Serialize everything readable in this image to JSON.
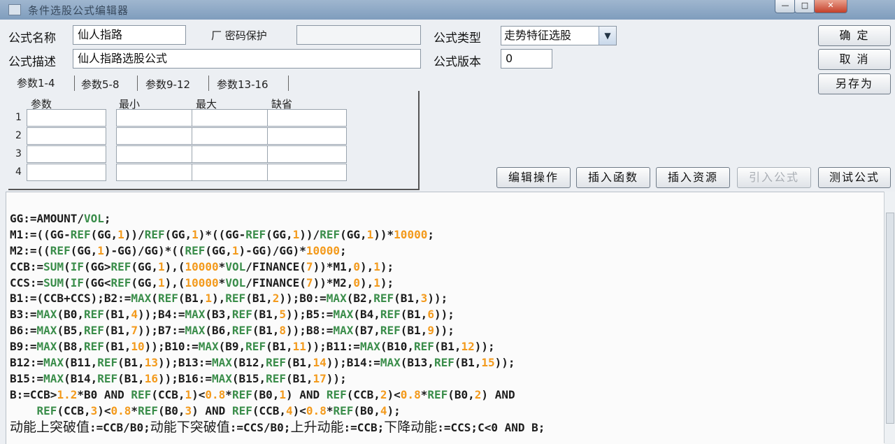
{
  "window": {
    "title": "条件选股公式编辑器",
    "minimize": "—",
    "maximize": "□",
    "close": "✕"
  },
  "form": {
    "name_label": "公式名称",
    "name_value": "仙人指路",
    "password_checkbox": "厂 密码保护",
    "password_value": "",
    "type_label": "公式类型",
    "type_value": "走势特征选股",
    "desc_label": "公式描述",
    "desc_value": "仙人指路选股公式",
    "version_label": "公式版本",
    "version_value": "0"
  },
  "buttons": {
    "ok": "确 定",
    "cancel": "取 消",
    "save_as": "另存为",
    "edit_ops": "编辑操作",
    "insert_func": "插入函数",
    "insert_resource": "插入资源",
    "import_formula": "引入公式",
    "test_formula": "测试公式"
  },
  "tabs": [
    "参数1-4",
    "参数5-8",
    "参数9-12",
    "参数13-16"
  ],
  "params": {
    "headers": [
      "参数",
      "最小",
      "最大",
      "缺省"
    ],
    "rows": [
      "1",
      "2",
      "3",
      "4"
    ]
  },
  "code": [
    [
      [
        "t",
        "GG:=AMOUNT/"
      ],
      [
        "f",
        "VOL"
      ],
      [
        "t",
        ";"
      ]
    ],
    [
      [
        "t",
        "M1:=((GG-"
      ],
      [
        "f",
        "REF"
      ],
      [
        "t",
        "(GG,"
      ],
      [
        "n",
        "1"
      ],
      [
        "t",
        "))/"
      ],
      [
        "f",
        "REF"
      ],
      [
        "t",
        "(GG,"
      ],
      [
        "n",
        "1"
      ],
      [
        "t",
        ")*((GG-"
      ],
      [
        "f",
        "REF"
      ],
      [
        "t",
        "(GG,"
      ],
      [
        "n",
        "1"
      ],
      [
        "t",
        "))/"
      ],
      [
        "f",
        "REF"
      ],
      [
        "t",
        "(GG,"
      ],
      [
        "n",
        "1"
      ],
      [
        "t",
        "))*"
      ],
      [
        "n",
        "10000"
      ],
      [
        "t",
        ";"
      ]
    ],
    [
      [
        "t",
        "M2:=(("
      ],
      [
        "f",
        "REF"
      ],
      [
        "t",
        "(GG,"
      ],
      [
        "n",
        "1"
      ],
      [
        "t",
        ")-GG)/GG)*(("
      ],
      [
        "f",
        "REF"
      ],
      [
        "t",
        "(GG,"
      ],
      [
        "n",
        "1"
      ],
      [
        "t",
        ")-GG)/GG)*"
      ],
      [
        "n",
        "10000"
      ],
      [
        "t",
        ";"
      ]
    ],
    [
      [
        "t",
        "CCB:="
      ],
      [
        "f",
        "SUM"
      ],
      [
        "t",
        "("
      ],
      [
        "f",
        "IF"
      ],
      [
        "t",
        "(GG>"
      ],
      [
        "f",
        "REF"
      ],
      [
        "t",
        "(GG,"
      ],
      [
        "n",
        "1"
      ],
      [
        "t",
        "),("
      ],
      [
        "n",
        "10000"
      ],
      [
        "t",
        "*"
      ],
      [
        "f",
        "VOL"
      ],
      [
        "t",
        "/FINANCE("
      ],
      [
        "n",
        "7"
      ],
      [
        "t",
        "))*M1,"
      ],
      [
        "n",
        "0"
      ],
      [
        "t",
        "),"
      ],
      [
        "n",
        "1"
      ],
      [
        "t",
        ");"
      ]
    ],
    [
      [
        "t",
        "CCS:="
      ],
      [
        "f",
        "SUM"
      ],
      [
        "t",
        "("
      ],
      [
        "f",
        "IF"
      ],
      [
        "t",
        "(GG<"
      ],
      [
        "f",
        "REF"
      ],
      [
        "t",
        "(GG,"
      ],
      [
        "n",
        "1"
      ],
      [
        "t",
        "),("
      ],
      [
        "n",
        "10000"
      ],
      [
        "t",
        "*"
      ],
      [
        "f",
        "VOL"
      ],
      [
        "t",
        "/FINANCE("
      ],
      [
        "n",
        "7"
      ],
      [
        "t",
        "))*M2,"
      ],
      [
        "n",
        "0"
      ],
      [
        "t",
        "),"
      ],
      [
        "n",
        "1"
      ],
      [
        "t",
        ");"
      ]
    ],
    [
      [
        "t",
        "B1:=(CCB+CCS);B2:="
      ],
      [
        "f",
        "MAX"
      ],
      [
        "t",
        "("
      ],
      [
        "f",
        "REF"
      ],
      [
        "t",
        "(B1,"
      ],
      [
        "n",
        "1"
      ],
      [
        "t",
        "),"
      ],
      [
        "f",
        "REF"
      ],
      [
        "t",
        "(B1,"
      ],
      [
        "n",
        "2"
      ],
      [
        "t",
        "));B0:="
      ],
      [
        "f",
        "MAX"
      ],
      [
        "t",
        "(B2,"
      ],
      [
        "f",
        "REF"
      ],
      [
        "t",
        "(B1,"
      ],
      [
        "n",
        "3"
      ],
      [
        "t",
        "));"
      ]
    ],
    [
      [
        "t",
        "B3:="
      ],
      [
        "f",
        "MAX"
      ],
      [
        "t",
        "(B0,"
      ],
      [
        "f",
        "REF"
      ],
      [
        "t",
        "(B1,"
      ],
      [
        "n",
        "4"
      ],
      [
        "t",
        "));B4:="
      ],
      [
        "f",
        "MAX"
      ],
      [
        "t",
        "(B3,"
      ],
      [
        "f",
        "REF"
      ],
      [
        "t",
        "(B1,"
      ],
      [
        "n",
        "5"
      ],
      [
        "t",
        "));B5:="
      ],
      [
        "f",
        "MAX"
      ],
      [
        "t",
        "(B4,"
      ],
      [
        "f",
        "REF"
      ],
      [
        "t",
        "(B1,"
      ],
      [
        "n",
        "6"
      ],
      [
        "t",
        "));"
      ]
    ],
    [
      [
        "t",
        "B6:="
      ],
      [
        "f",
        "MAX"
      ],
      [
        "t",
        "(B5,"
      ],
      [
        "f",
        "REF"
      ],
      [
        "t",
        "(B1,"
      ],
      [
        "n",
        "7"
      ],
      [
        "t",
        "));B7:="
      ],
      [
        "f",
        "MAX"
      ],
      [
        "t",
        "(B6,"
      ],
      [
        "f",
        "REF"
      ],
      [
        "t",
        "(B1,"
      ],
      [
        "n",
        "8"
      ],
      [
        "t",
        "));B8:="
      ],
      [
        "f",
        "MAX"
      ],
      [
        "t",
        "(B7,"
      ],
      [
        "f",
        "REF"
      ],
      [
        "t",
        "(B1,"
      ],
      [
        "n",
        "9"
      ],
      [
        "t",
        "));"
      ]
    ],
    [
      [
        "t",
        "B9:="
      ],
      [
        "f",
        "MAX"
      ],
      [
        "t",
        "(B8,"
      ],
      [
        "f",
        "REF"
      ],
      [
        "t",
        "(B1,"
      ],
      [
        "n",
        "10"
      ],
      [
        "t",
        "));B10:="
      ],
      [
        "f",
        "MAX"
      ],
      [
        "t",
        "(B9,"
      ],
      [
        "f",
        "REF"
      ],
      [
        "t",
        "(B1,"
      ],
      [
        "n",
        "11"
      ],
      [
        "t",
        "));B11:="
      ],
      [
        "f",
        "MAX"
      ],
      [
        "t",
        "(B10,"
      ],
      [
        "f",
        "REF"
      ],
      [
        "t",
        "(B1,"
      ],
      [
        "n",
        "12"
      ],
      [
        "t",
        "));"
      ]
    ],
    [
      [
        "t",
        "B12:="
      ],
      [
        "f",
        "MAX"
      ],
      [
        "t",
        "(B11,"
      ],
      [
        "f",
        "REF"
      ],
      [
        "t",
        "(B1,"
      ],
      [
        "n",
        "13"
      ],
      [
        "t",
        "));B13:="
      ],
      [
        "f",
        "MAX"
      ],
      [
        "t",
        "(B12,"
      ],
      [
        "f",
        "REF"
      ],
      [
        "t",
        "(B1,"
      ],
      [
        "n",
        "14"
      ],
      [
        "t",
        "));B14:="
      ],
      [
        "f",
        "MAX"
      ],
      [
        "t",
        "(B13,"
      ],
      [
        "f",
        "REF"
      ],
      [
        "t",
        "(B1,"
      ],
      [
        "n",
        "15"
      ],
      [
        "t",
        "));"
      ]
    ],
    [
      [
        "t",
        "B15:="
      ],
      [
        "f",
        "MAX"
      ],
      [
        "t",
        "(B14,"
      ],
      [
        "f",
        "REF"
      ],
      [
        "t",
        "(B1,"
      ],
      [
        "n",
        "16"
      ],
      [
        "t",
        "));B16:="
      ],
      [
        "f",
        "MAX"
      ],
      [
        "t",
        "(B15,"
      ],
      [
        "f",
        "REF"
      ],
      [
        "t",
        "(B1,"
      ],
      [
        "n",
        "17"
      ],
      [
        "t",
        "));"
      ]
    ],
    [
      [
        "t",
        "B:=CCB>"
      ],
      [
        "n",
        "1.2"
      ],
      [
        "t",
        "*B0 AND "
      ],
      [
        "f",
        "REF"
      ],
      [
        "t",
        "(CCB,"
      ],
      [
        "n",
        "1"
      ],
      [
        "t",
        ")<"
      ],
      [
        "n",
        "0.8"
      ],
      [
        "t",
        "*"
      ],
      [
        "f",
        "REF"
      ],
      [
        "t",
        "(B0,"
      ],
      [
        "n",
        "1"
      ],
      [
        "t",
        ") AND "
      ],
      [
        "f",
        "REF"
      ],
      [
        "t",
        "(CCB,"
      ],
      [
        "n",
        "2"
      ],
      [
        "t",
        ")<"
      ],
      [
        "n",
        "0.8"
      ],
      [
        "t",
        "*"
      ],
      [
        "f",
        "REF"
      ],
      [
        "t",
        "(B0,"
      ],
      [
        "n",
        "2"
      ],
      [
        "t",
        ") AND"
      ]
    ],
    [
      [
        "t",
        "    "
      ],
      [
        "f",
        "REF"
      ],
      [
        "t",
        "(CCB,"
      ],
      [
        "n",
        "3"
      ],
      [
        "t",
        ")<"
      ],
      [
        "n",
        "0.8"
      ],
      [
        "t",
        "*"
      ],
      [
        "f",
        "REF"
      ],
      [
        "t",
        "(B0,"
      ],
      [
        "n",
        "3"
      ],
      [
        "t",
        ") AND "
      ],
      [
        "f",
        "REF"
      ],
      [
        "t",
        "(CCB,"
      ],
      [
        "n",
        "4"
      ],
      [
        "t",
        ")<"
      ],
      [
        "n",
        "0.8"
      ],
      [
        "t",
        "*"
      ],
      [
        "f",
        "REF"
      ],
      [
        "t",
        "(B0,"
      ],
      [
        "n",
        "4"
      ],
      [
        "t",
        ");"
      ]
    ],
    [
      [
        "c",
        "动能上突破值"
      ],
      [
        "t",
        ":=CCB/B0;"
      ],
      [
        "c",
        "动能下突破值"
      ],
      [
        "t",
        ":=CCS/B0;"
      ],
      [
        "c",
        "上升动能"
      ],
      [
        "t",
        ":=CCB;"
      ],
      [
        "c",
        "下降动能"
      ],
      [
        "t",
        ":=CCS;C<0 AND B;"
      ]
    ]
  ],
  "colors": {
    "function": "#3a8d4a",
    "number": "#f39a1c",
    "text": "#1c1c1c"
  }
}
